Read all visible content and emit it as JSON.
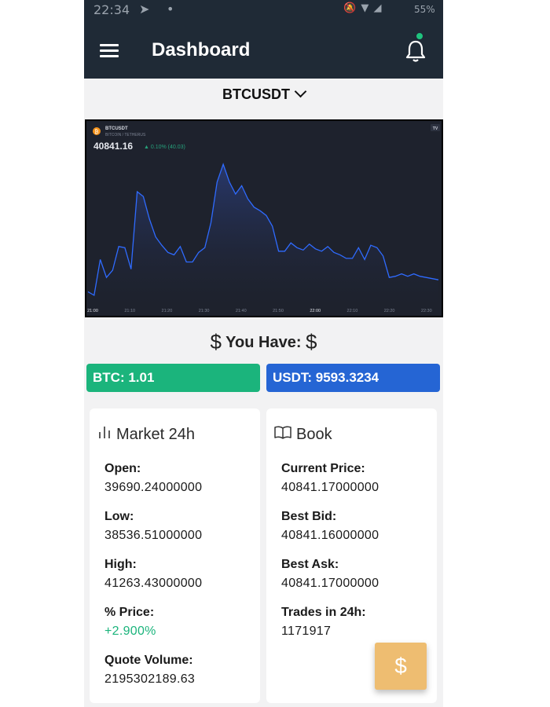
{
  "status_bar": {
    "time": "22:34",
    "battery": "55%"
  },
  "header": {
    "title": "Dashboard"
  },
  "symbol_selector": {
    "label": "BTCUSDT"
  },
  "chart_widget": {
    "symbol": "BTCUSDT",
    "pair_name": "BITCOIN / TETHERUS",
    "last_price": "40841.16",
    "change": "▲ 0.10% (40.03)",
    "brand": "TV"
  },
  "chart_data": {
    "type": "line",
    "x_tick_labels": [
      "21:00",
      "21:10",
      "21:20",
      "21:30",
      "21:40",
      "21:50",
      "22:00",
      "22:10",
      "22:20",
      "22:30"
    ],
    "series": [
      {
        "values": [
          38920,
          38890,
          39190,
          39040,
          39100,
          39300,
          39290,
          39110,
          39760,
          39720,
          39530,
          39380,
          39310,
          39250,
          39230,
          39300,
          39170,
          39170,
          39250,
          39290,
          39500,
          39840,
          39990,
          39840,
          39740,
          39810,
          39700,
          39630,
          39600,
          39560,
          39470,
          39260,
          39260,
          39330,
          39290,
          39270,
          39320,
          39280,
          39260,
          39300,
          39250,
          39230,
          39200,
          39200,
          39290,
          39190,
          39310,
          39290,
          39220,
          39040,
          39050,
          39070,
          39050,
          39070,
          39050,
          39040,
          39030,
          39020
        ]
      }
    ],
    "line_color": "#2f6bff",
    "background": "#1e222d"
  },
  "you_have": {
    "label": "You Have:"
  },
  "balances": {
    "btc": "BTC: 1.01",
    "usdt": "USDT: 9593.3234"
  },
  "market": {
    "title": "Market 24h",
    "open_label": "Open:",
    "open_value": "39690.24000000",
    "low_label": "Low:",
    "low_value": "38536.51000000",
    "high_label": "High:",
    "high_value": "41263.43000000",
    "price_label": "% Price:",
    "price_value": "+2.900%",
    "volume_label": "Quote Volume:",
    "volume_value": "2195302189.63"
  },
  "book": {
    "title": "Book",
    "current_label": "Current Price:",
    "current_value": "40841.17000000",
    "bid_label": "Best Bid:",
    "bid_value": "40841.16000000",
    "ask_label": "Best Ask:",
    "ask_value": "40841.17000000",
    "trades_label": "Trades in 24h:",
    "trades_value": "1171917"
  },
  "fab": {
    "symbol": "$"
  },
  "colors": {
    "header_bg": "#1f2a36",
    "btc_green": "#1bb47c",
    "usdt_blue": "#2565d4",
    "fab_orange": "#eebd71"
  }
}
